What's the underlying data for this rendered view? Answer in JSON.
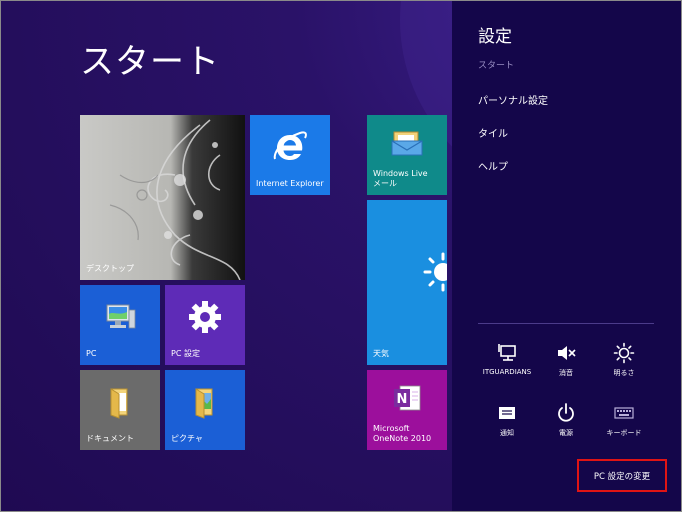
{
  "start": {
    "title": "スタート"
  },
  "tiles": {
    "desktop": "デスクトップ",
    "ie": "Internet Explorer",
    "mail": "Windows Live\nメール",
    "pc": "PC",
    "pc_settings": "PC 設定",
    "weather": "天気",
    "documents": "ドキュメント",
    "pictures": "ピクチャ",
    "onenote": "Microsoft\nOneNote 2010"
  },
  "charm": {
    "title": "設定",
    "subtitle": "スタート",
    "items": [
      "パーソナル設定",
      "タイル",
      "ヘルプ"
    ],
    "system": [
      {
        "label": "ITGUARDIANS",
        "icon": "network-icon"
      },
      {
        "label": "消音",
        "icon": "volume-mute-icon"
      },
      {
        "label": "明るさ",
        "icon": "brightness-icon"
      },
      {
        "label": "通知",
        "icon": "notifications-icon"
      },
      {
        "label": "電源",
        "icon": "power-icon"
      },
      {
        "label": "キーボード",
        "icon": "keyboard-icon"
      }
    ],
    "change_pc_settings": "PC 設定の変更"
  },
  "colors": {
    "background": "#26105f",
    "charm_bar": "#14064a",
    "tile_blue": "#1b5fd6",
    "tile_purple": "#5e2bb7",
    "tile_teal": "#0f8a8a",
    "tile_gray": "#6b6b6b",
    "tile_magenta": "#9c0f9c",
    "highlight_red": "#e01414"
  }
}
